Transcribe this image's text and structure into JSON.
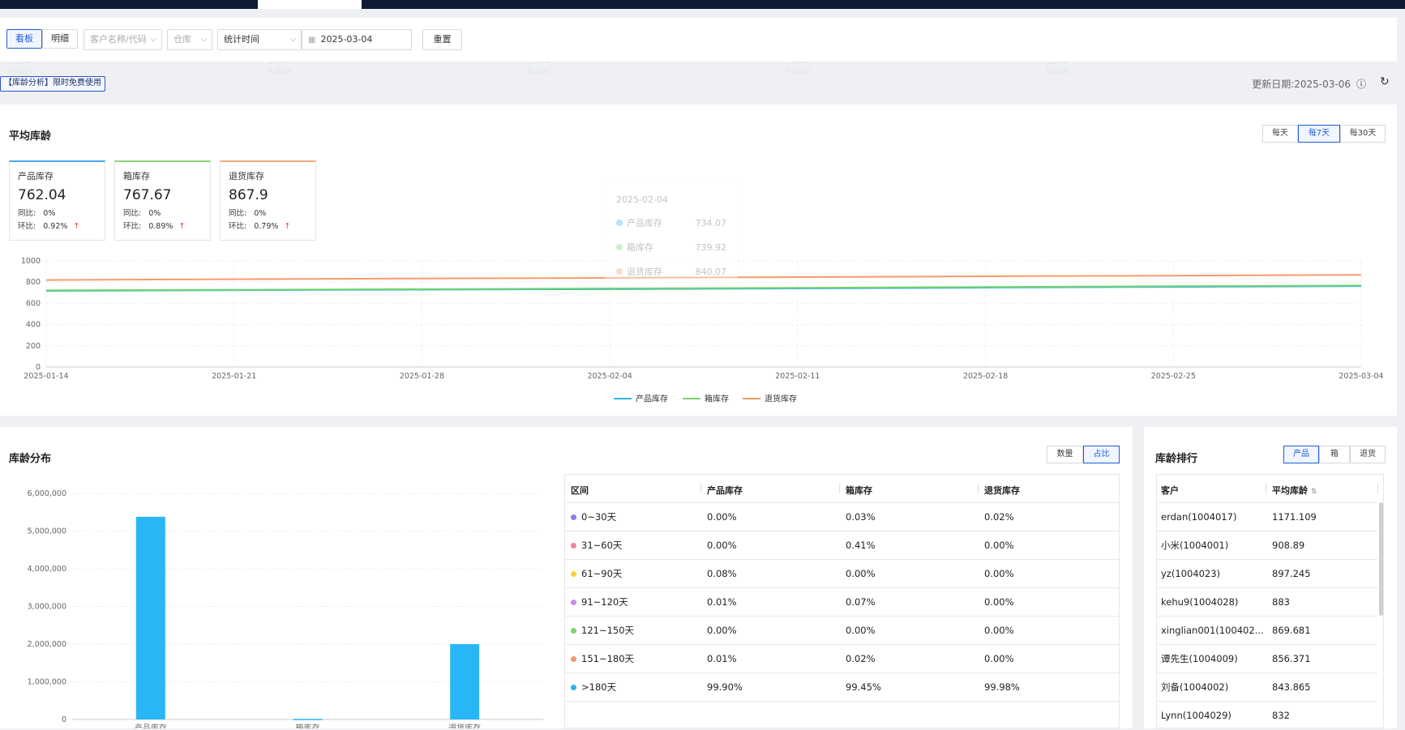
{
  "filters": {
    "tab_board": "看板",
    "tab_detail": "明细",
    "customer_placeholder": "客户名称/代码",
    "warehouse_placeholder": "仓库",
    "stat_time": "统计时间",
    "date": "2025-03-04",
    "reset": "重置"
  },
  "promo": "【库龄分析】限时免费使用",
  "updated": "更新日期:2025-03-06",
  "avg_age": {
    "title": "平均库龄",
    "periods": [
      "每天",
      "每7天",
      "每30天"
    ],
    "active_period": 1,
    "cards": [
      {
        "label": "产品库存",
        "value": "762.04",
        "yoy_label": "同比:",
        "yoy": "0%",
        "mom_label": "环比:",
        "mom": "0.92%",
        "color": "#4aa8f0"
      },
      {
        "label": "箱库存",
        "value": "767.67",
        "yoy_label": "同比:",
        "yoy": "0%",
        "mom_label": "环比:",
        "mom": "0.89%",
        "color": "#8cd37a"
      },
      {
        "label": "退货库存",
        "value": "867.9",
        "yoy_label": "同比:",
        "yoy": "0%",
        "mom_label": "环比:",
        "mom": "0.79%",
        "color": "#f7a77a"
      }
    ],
    "tooltip": {
      "date": "2025-02-04",
      "items": [
        {
          "name": "产品库存",
          "value": "734.07",
          "color": "#2bb3f5"
        },
        {
          "name": "箱库存",
          "value": "739.92",
          "color": "#76d36b"
        },
        {
          "name": "退货库存",
          "value": "840.07",
          "color": "#fb9a6b"
        }
      ]
    }
  },
  "chart_data": [
    {
      "type": "line",
      "x": [
        "2025-01-14",
        "2025-01-21",
        "2025-01-28",
        "2025-02-04",
        "2025-02-11",
        "2025-02-18",
        "2025-02-25",
        "2025-03-04"
      ],
      "ylim": [
        0,
        1000
      ],
      "yticks": [
        0,
        200,
        400,
        600,
        800,
        1000
      ],
      "series": [
        {
          "name": "产品库存",
          "color": "#2bb3f5",
          "values": [
            718,
            724,
            729,
            734,
            740,
            748,
            755,
            762
          ]
        },
        {
          "name": "箱库存",
          "color": "#76d36b",
          "values": [
            722,
            728,
            734,
            740,
            746,
            754,
            761,
            768
          ]
        },
        {
          "name": "退货库存",
          "color": "#fb9a6b",
          "values": [
            820,
            827,
            834,
            840,
            847,
            855,
            861,
            868
          ]
        }
      ],
      "legend": "bottom"
    },
    {
      "type": "bar",
      "categories": [
        "产品库存",
        "箱库存",
        "退货库存"
      ],
      "values": [
        5380000,
        15000,
        2000000
      ],
      "ylim": [
        0,
        6000000
      ],
      "yticks": [
        "0",
        "1,000,000",
        "2,000,000",
        "3,000,000",
        "4,000,000",
        "5,000,000",
        "6,000,000"
      ],
      "color": "#29b6f6"
    }
  ],
  "distribution": {
    "title": "库龄分布",
    "toggle": [
      "数量",
      "占比"
    ],
    "active_toggle": 1,
    "headers": [
      "区间",
      "产品库存",
      "箱库存",
      "退货库存"
    ],
    "rows": [
      {
        "range": "0~30天",
        "color": "#8a7df0",
        "p": "0.00%",
        "b": "0.03%",
        "r": "0.02%"
      },
      {
        "range": "31~60天",
        "color": "#f0849c",
        "p": "0.00%",
        "b": "0.41%",
        "r": "0.00%"
      },
      {
        "range": "61~90天",
        "color": "#f5d23a",
        "p": "0.08%",
        "b": "0.00%",
        "r": "0.00%"
      },
      {
        "range": "91~120天",
        "color": "#c58af0",
        "p": "0.01%",
        "b": "0.07%",
        "r": "0.00%"
      },
      {
        "range": "121~150天",
        "color": "#7fd36b",
        "p": "0.00%",
        "b": "0.00%",
        "r": "0.00%"
      },
      {
        "range": "151~180天",
        "color": "#f5996b",
        "p": "0.01%",
        "b": "0.02%",
        "r": "0.00%"
      },
      {
        "range": ">180天",
        "color": "#2fb0f0",
        "p": "99.90%",
        "b": "99.45%",
        "r": "99.98%"
      }
    ]
  },
  "ranking": {
    "title": "库龄排行",
    "tabs": [
      "产品",
      "箱",
      "退货"
    ],
    "active_tab": 0,
    "headers": [
      "客户",
      "平均库龄"
    ],
    "rows": [
      {
        "customer": "erdan(1004017)",
        "age": "1171.109"
      },
      {
        "customer": "小米(1004001)",
        "age": "908.89"
      },
      {
        "customer": "yz(1004023)",
        "age": "897.245"
      },
      {
        "customer": "kehu9(1004028)",
        "age": "883"
      },
      {
        "customer": "xinglian001(100402...",
        "age": "869.681"
      },
      {
        "customer": "谭先生(1004009)",
        "age": "856.371"
      },
      {
        "customer": "刘备(1004002)",
        "age": "843.865"
      },
      {
        "customer": "Lynn(1004029)",
        "age": "832"
      }
    ]
  }
}
